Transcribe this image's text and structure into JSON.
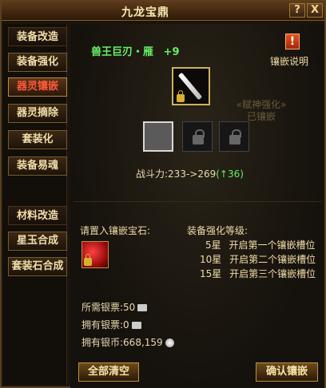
{
  "window": {
    "title": "九龙宝鼎",
    "help_label": "?",
    "close_label": "X"
  },
  "sidebar": {
    "group1_header": "装备改造",
    "items1": [
      "装备强化",
      "器灵镶嵌",
      "器灵摘除",
      "套装化",
      "装备易魂"
    ],
    "group2_header": "材料改造",
    "items2": [
      "星玉合成",
      "套装石合成"
    ],
    "active": "器灵镶嵌"
  },
  "item": {
    "name": "兽王巨刃・雁",
    "plus": "+9",
    "faded_text": "«赋神强化»\n已镶嵌"
  },
  "help": {
    "icon": "!",
    "label": "镶嵌说明"
  },
  "power": {
    "label": "战斗力:",
    "from": "233",
    "arrow": "->",
    "to": "269",
    "gain": "(↑36)"
  },
  "gem_section": {
    "label": "请置入镶嵌宝石:"
  },
  "levels": {
    "title": "装备强化等级:",
    "rows": [
      {
        "star": "5星",
        "text": "开启第一个镶嵌槽位"
      },
      {
        "star": "10星",
        "text": "开启第二个镶嵌槽位"
      },
      {
        "star": "15星",
        "text": "开启第三个镶嵌槽位"
      }
    ]
  },
  "money": {
    "required_label": "所需银票:",
    "required_value": "50",
    "own_label": "拥有银票:",
    "own_value": "0",
    "coin_label": "拥有银币:",
    "coin_value": "668,159"
  },
  "buttons": {
    "clear": "全部清空",
    "confirm": "确认镶嵌"
  },
  "colors": {
    "accent": "#66ee66",
    "active_tab": "#ff5a3a",
    "border": "#c09040"
  }
}
